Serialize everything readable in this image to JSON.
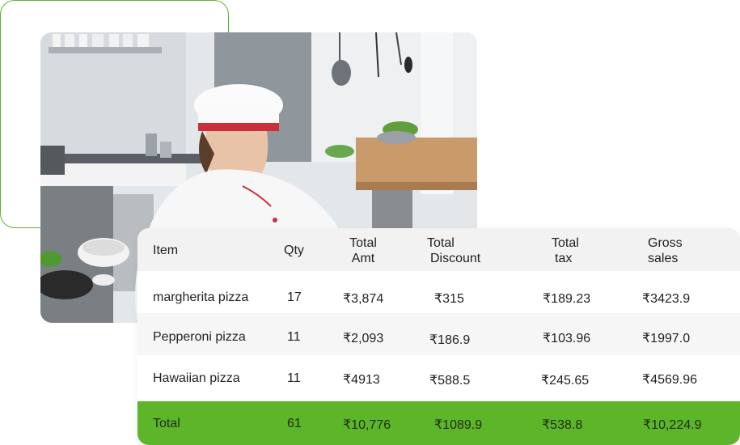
{
  "table": {
    "headers": {
      "item": "Item",
      "qty": "Qty",
      "total_amt": [
        "Total",
        "Amt"
      ],
      "total_discount": [
        "Total",
        "Discount"
      ],
      "total_tax": [
        "Total",
        "tax"
      ],
      "gross_sales": [
        "Gross",
        "sales"
      ]
    },
    "rows": [
      {
        "item": "margherita pizza",
        "qty": "17",
        "total_amt": "₹3,874",
        "total_discount": "₹315",
        "total_tax": "₹189.23",
        "gross_sales": "₹3423.9"
      },
      {
        "item": "Pepperoni pizza",
        "qty": "11",
        "total_amt": "₹2,093",
        "total_discount": "₹186.9",
        "total_tax": "₹103.96",
        "gross_sales": "₹1997.0"
      },
      {
        "item": "Hawaiian pizza",
        "qty": "11",
        "total_amt": "₹4913",
        "total_discount": "₹588.5",
        "total_tax": "₹245.65",
        "gross_sales": "₹4569.96"
      }
    ],
    "total": {
      "item": "Total",
      "qty": "61",
      "total_amt": "₹10,776",
      "total_discount": "₹1089.9",
      "total_tax": "₹538.8",
      "gross_sales": "₹10,224.9"
    }
  },
  "colors": {
    "accent_green": "#5db52a",
    "header_bg": "#f2f2f2",
    "stripe_bg": "#f6f6f6"
  }
}
